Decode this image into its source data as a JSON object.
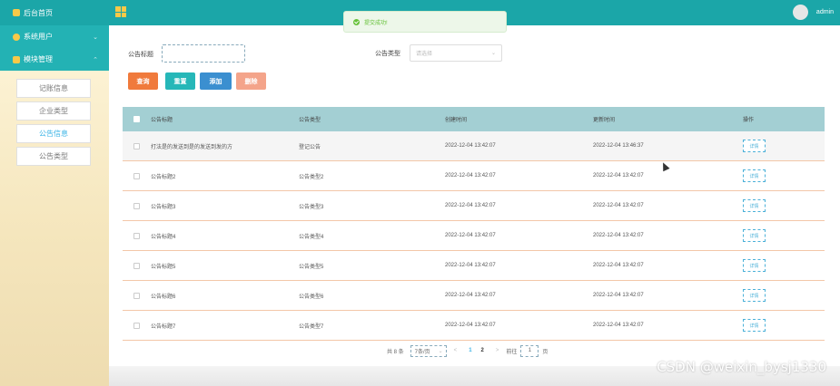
{
  "sidebar": {
    "home_label": "后台首页",
    "groups": [
      {
        "label": "系统用户"
      },
      {
        "label": "模块管理"
      }
    ],
    "items": [
      {
        "label": "记账信息",
        "active": false
      },
      {
        "label": "企业类型",
        "active": false
      },
      {
        "label": "公告信息",
        "active": true
      },
      {
        "label": "公告类型",
        "active": false
      }
    ]
  },
  "topbar": {
    "user": "admin",
    "bg_color": "#1ba6a8"
  },
  "toast": {
    "message": "提交成功!"
  },
  "search": {
    "title_label": "公告标题",
    "title_value": "",
    "type_label": "公告类型",
    "type_placeholder": "请选择"
  },
  "buttons": {
    "query": "查询",
    "reset": "重置",
    "add": "添加",
    "delete": "删除"
  },
  "table": {
    "headers": [
      "公告标题",
      "公告类型",
      "创建时间",
      "更新时间",
      "操作"
    ],
    "detail_label": "详情",
    "rows": [
      {
        "title": "打法是的发送到是的发送到发的方",
        "type": "登记公告",
        "created": "2022-12-04 13:42:07",
        "updated": "2022-12-04 13:46:37"
      },
      {
        "title": "公告标题2",
        "type": "公告类型2",
        "created": "2022-12-04 13:42:07",
        "updated": "2022-12-04 13:42:07"
      },
      {
        "title": "公告标题3",
        "type": "公告类型3",
        "created": "2022-12-04 13:42:07",
        "updated": "2022-12-04 13:42:07"
      },
      {
        "title": "公告标题4",
        "type": "公告类型4",
        "created": "2022-12-04 13:42:07",
        "updated": "2022-12-04 13:42:07"
      },
      {
        "title": "公告标题5",
        "type": "公告类型5",
        "created": "2022-12-04 13:42:07",
        "updated": "2022-12-04 13:42:07"
      },
      {
        "title": "公告标题6",
        "type": "公告类型6",
        "created": "2022-12-04 13:42:07",
        "updated": "2022-12-04 13:42:07"
      },
      {
        "title": "公告标题7",
        "type": "公告类型7",
        "created": "2022-12-04 13:42:07",
        "updated": "2022-12-04 13:42:07"
      }
    ]
  },
  "pagination": {
    "total": "共 8 条",
    "page_size": "7条/页",
    "prev": "<",
    "pages": [
      "1",
      "2"
    ],
    "current_page": "1",
    "next": ">",
    "goto_label": "前往",
    "goto_value": "1",
    "page_unit": "页"
  },
  "watermark": "CSDN @weixin_bysj1330"
}
